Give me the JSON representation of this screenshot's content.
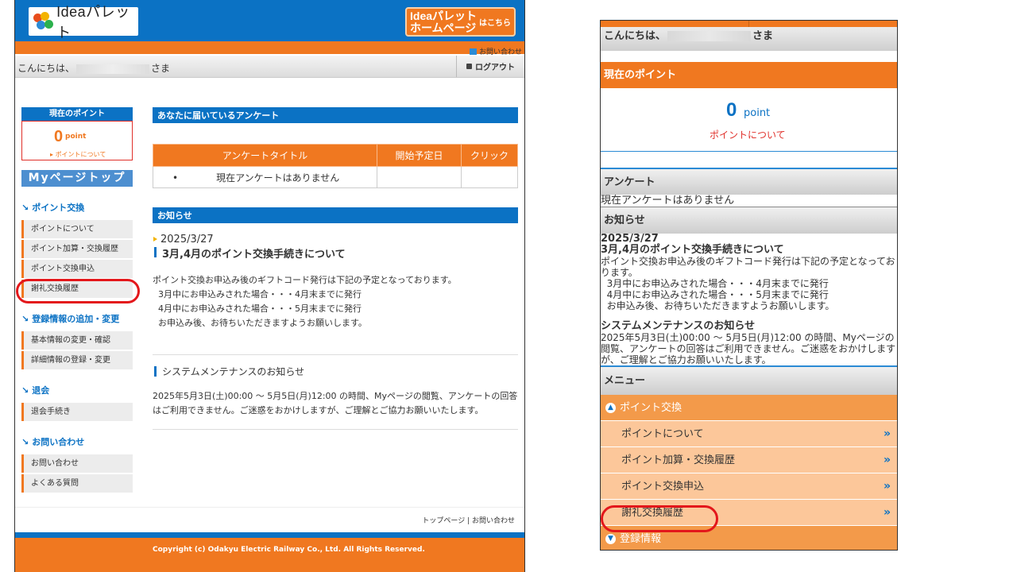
{
  "pc": {
    "logo_text": "Ideaパレット",
    "hp_button": {
      "line1": "Ideaパレット",
      "line2": "ホームページ",
      "small": "はこちら"
    },
    "contact_link": "お問い合わせ",
    "greeting_prefix": "こんにちは、",
    "greeting_suffix": "さま",
    "logout": "ログアウト",
    "points": {
      "header": "現在のポイント",
      "value": "0",
      "unit": "point",
      "about": "ポイントについて"
    },
    "mypage_top": "Myページトップ",
    "sections": [
      {
        "title": "ポイント交換",
        "items": [
          "ポイントについて",
          "ポイント加算・交換履歴",
          "ポイント交換申込",
          "謝礼交換履歴"
        ]
      },
      {
        "title": "登録情報の追加・変更",
        "items": [
          "基本情報の変更・確認",
          "詳細情報の登録・変更"
        ]
      },
      {
        "title": "退会",
        "items": [
          "退会手続き"
        ]
      },
      {
        "title": "お問い合わせ",
        "items": [
          "お問い合わせ",
          "よくある質問"
        ]
      }
    ],
    "survey": {
      "header": "あなたに届いているアンケート",
      "columns": [
        "アンケートタイトル",
        "開始予定日",
        "クリック"
      ],
      "bullet": "•",
      "empty": "現在アンケートはありません"
    },
    "news": {
      "header": "お知らせ",
      "date": "2025/3/27",
      "title": "3月,4月のポイント交換手続きについて",
      "body": [
        "ポイント交換お申込み後のギフトコード発行は下記の予定となっております。",
        "  3月中にお申込みされた場合・・・4月末までに発行",
        "  4月中にお申込みされた場合・・・5月末までに発行",
        "  お申込み後、お待ちいただきますようお願いします。"
      ],
      "title2": "システムメンテナンスのお知らせ",
      "body2": "2025年5月3日(土)00:00 ～ 5月5日(月)12:00 の時間、Myページの閲覧、アンケートの回答はご利用できません。ご迷惑をおかけしますが、ご理解とご協力お願いいたします。"
    },
    "footer_links": "トップページ | お問い合わせ",
    "copyright": "Copyright (c) Odakyu Electric Railway Co., Ltd. All Rights Reserved."
  },
  "sp": {
    "greeting_prefix": "こんにちは、",
    "greeting_suffix": "さま",
    "points": {
      "header": "現在のポイント",
      "value": "0",
      "unit": "point",
      "about": "ポイントについて"
    },
    "survey_header": "アンケート",
    "survey_empty": "現在アンケートはありません",
    "news_header": "お知らせ",
    "news": {
      "date": "2025/3/27",
      "title": "3月,4月のポイント交換手続きについて",
      "body": [
        "ポイント交換お申込み後のギフトコード発行は下記の予定となってお",
        "ります。",
        "  3月中にお申込みされた場合・・・4月末までに発行",
        "  4月中にお申込みされた場合・・・5月末までに発行",
        "  お申込み後、お待ちいただきますようお願いします。"
      ],
      "title2": "システムメンテナンスのお知らせ",
      "body2": "2025年5月3日(土)00:00 ～ 5月5日(月)12:00 の時間、Myページの閲覧、アンケートの回答はご利用できません。ご迷惑をおかけしますが、ご理解とご協力お願いいたします。"
    },
    "menu_header": "メニュー",
    "menu_cat1": "ポイント交換",
    "menu_items": [
      "ポイントについて",
      "ポイント加算・交換履歴",
      "ポイント交換申込",
      "謝礼交換履歴"
    ],
    "menu_cat2": "登録情報",
    "chevron": "»"
  },
  "colors": {
    "blue": "#0b72c4",
    "orange": "#f07820",
    "highlight": "#e3171b"
  }
}
